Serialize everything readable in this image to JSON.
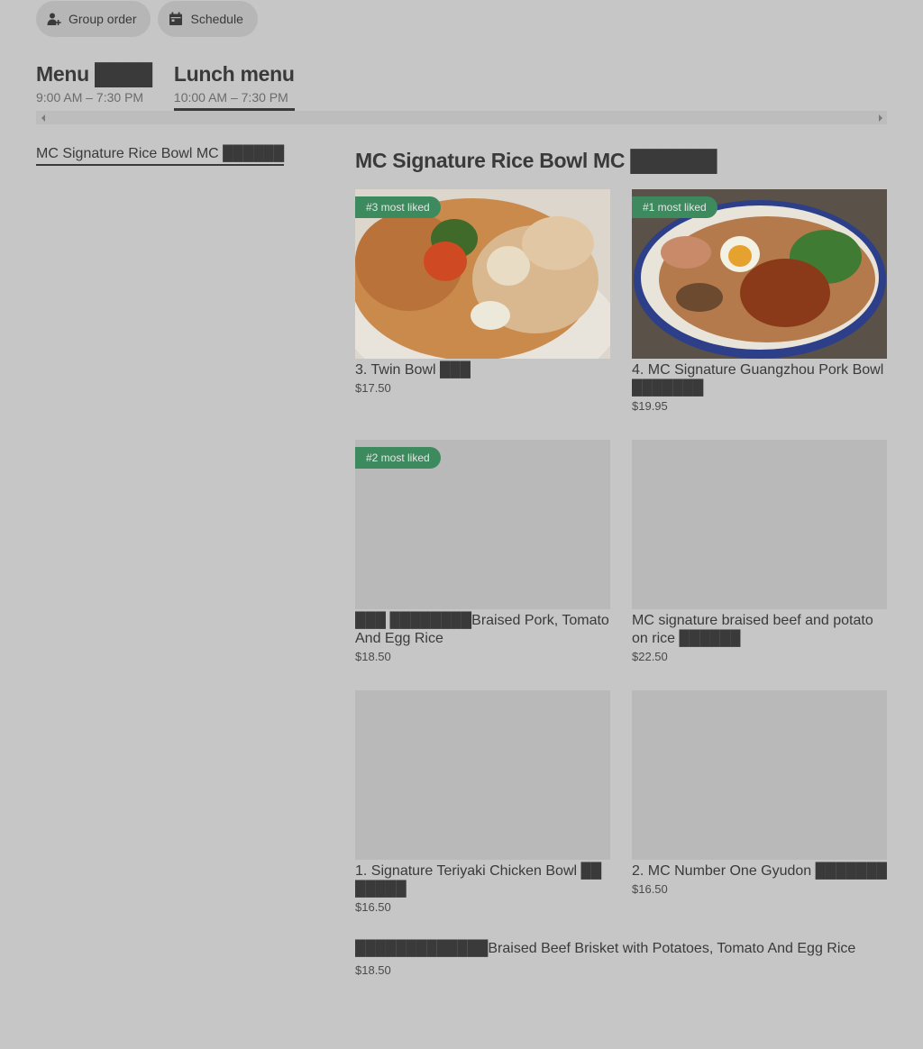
{
  "top_buttons": {
    "group_order": "Group order",
    "schedule": "Schedule"
  },
  "menus": [
    {
      "title": "Menu ████",
      "hours": "9:00 AM – 7:30 PM"
    },
    {
      "title": "Lunch menu",
      "hours": "10:00 AM – 7:30 PM"
    }
  ],
  "category_link": "MC Signature Rice Bowl MC ██████",
  "section_title": "MC Signature Rice Bowl MC ██████",
  "items": [
    {
      "name": "3. Twin Bowl ███",
      "price": "$17.50",
      "badge": "#3 most liked"
    },
    {
      "name": "4. MC Signature Guangzhou Pork Bowl ███████",
      "price": "$19.95",
      "badge": "#1 most liked"
    },
    {
      "name": "███ ████████Braised Pork, Tomato And Egg Rice",
      "price": "$18.50",
      "badge": "#2 most liked"
    },
    {
      "name": "MC signature braised  beef and potato on rice ██████",
      "price": "$22.50"
    },
    {
      "name": "1. Signature Teriyaki Chicken Bowl ██ █████",
      "price": "$16.50"
    },
    {
      "name": "2. MC Number One Gyudon ███████",
      "price": "$16.50"
    },
    {
      "name": "█████████████Braised Beef Brisket with Potatoes, Tomato And Egg Rice",
      "price": "$18.50"
    }
  ],
  "colors": {
    "background": "#c6c6c6",
    "badge": "#3d8a5e",
    "text": "#3a3a3a"
  }
}
